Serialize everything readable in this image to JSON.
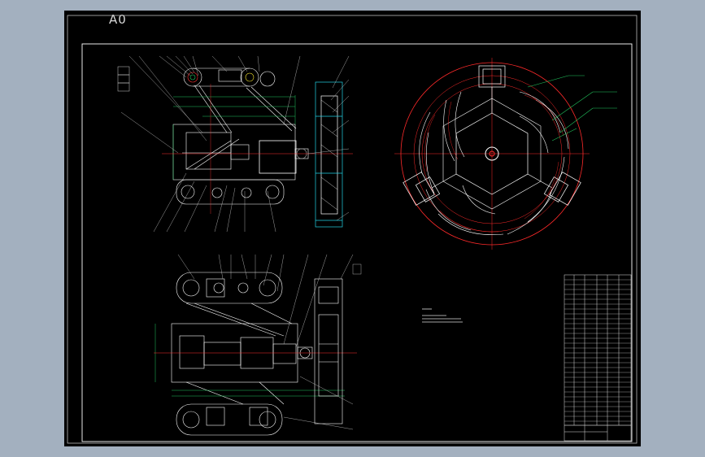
{
  "sheet": {
    "title": "A0",
    "background_color": "#a3b0bf",
    "paper_color": "#000000"
  },
  "colors": {
    "outline": "#ffffff",
    "centerline": "#ff2a2a",
    "cyan": "#22d3e6",
    "dimension": "#22c55e",
    "leader": "#d0d0d0",
    "yellow": "#ffee33"
  }
}
